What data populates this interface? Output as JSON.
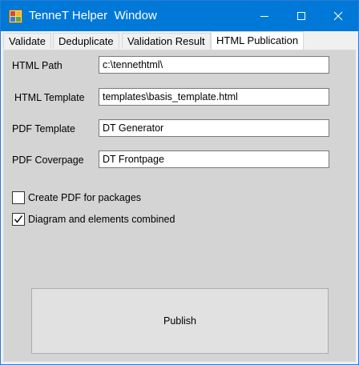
{
  "window": {
    "title": "TenneT Helper  Window",
    "minimize_glyph": "minimize-icon",
    "maximize_glyph": "maximize-icon",
    "close_glyph": "close-icon",
    "accent": "#0078d7"
  },
  "tabs": [
    {
      "label": "Validate"
    },
    {
      "label": "Deduplicate"
    },
    {
      "label": "Validation Result"
    },
    {
      "label": "HTML Publication",
      "active": true
    }
  ],
  "form": {
    "html_path": {
      "label": "HTML Path",
      "value": "c:\\tennethtml\\"
    },
    "html_template": {
      "label": "HTML Template",
      "value": "templates\\basis_template.html"
    },
    "pdf_template": {
      "label": "PDF Template",
      "value": "DT Generator"
    },
    "pdf_coverpage": {
      "label": "PDF Coverpage",
      "value": "DT Frontpage"
    }
  },
  "options": {
    "create_pdf": {
      "label": "Create PDF for packages",
      "checked": false
    },
    "diagram_combined": {
      "label": "Diagram and elements combined",
      "checked": true
    }
  },
  "actions": {
    "publish_label": "Publish"
  }
}
